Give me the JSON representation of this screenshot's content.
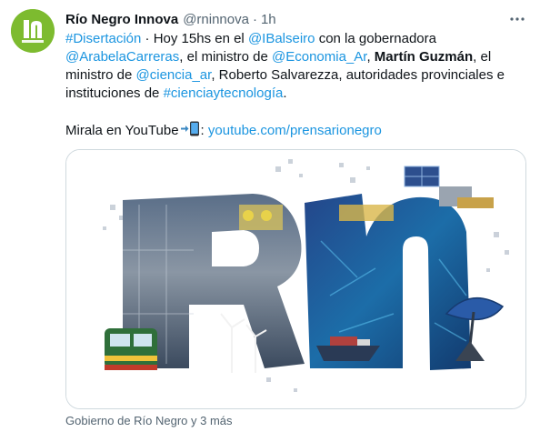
{
  "tweet": {
    "author_name": "Río Negro Innova",
    "handle": "@rninnova",
    "separator": "·",
    "time": "1h",
    "text": {
      "l1_hashtag": "#Disertación",
      "l1_text": " · Hoy 15hs en el ",
      "l1_mention": "@IBalseiro",
      "l1_text2": " con la gobernadora",
      "l2_mention": "@ArabelaCarreras",
      "l2_text": ", el ministro de ",
      "l2_mention2": "@Economia_Ar",
      "l2_sep": ", ",
      "l2_bold": "Martín Guzmán",
      "l2_text2": ", el",
      "l3_text": "ministro de ",
      "l3_mention": "@ciencia_ar",
      "l3_text2": ", Roberto Salvarezza, autoridades provinciales e",
      "l4_text": "instituciones de ",
      "l4_hashtag": "#cienciaytecnología",
      "l4_text2": ".",
      "youtube_text": "Mirala en YouTube",
      "youtube_sep": ": ",
      "youtube_link": "youtube.com/prensarionegro"
    },
    "footer": "Gobierno de Río Negro y 3 más"
  },
  "icons": {
    "avatar": "rn-logo-icon",
    "more": "more-options-icon",
    "emoji": "mobile-phone-arrow-icon"
  },
  "colors": {
    "link": "#1b95e0",
    "text": "#0f1419",
    "secondary": "#536471",
    "brand_green": "#7dbb2f",
    "card_border": "#cfd9de"
  }
}
